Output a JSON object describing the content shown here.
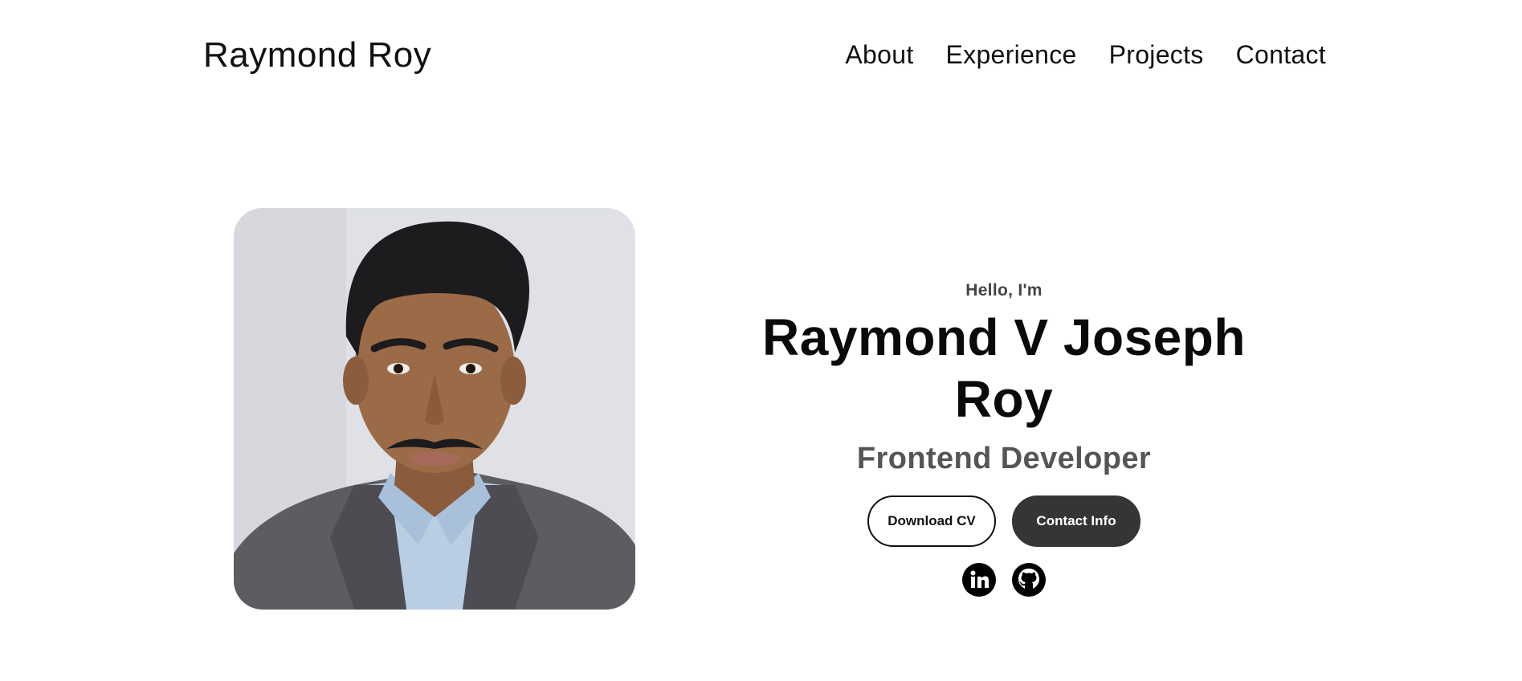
{
  "nav": {
    "logo": "Raymond Roy",
    "links": [
      "About",
      "Experience",
      "Projects",
      "Contact"
    ]
  },
  "hero": {
    "greeting": "Hello, I'm",
    "name": "Raymond V Joseph Roy",
    "title": "Frontend Developer",
    "buttons": {
      "download_cv": "Download CV",
      "contact_info": "Contact Info"
    },
    "socials": [
      "linkedin-icon",
      "github-icon"
    ],
    "profile_image": "profile-photo"
  },
  "colors": {
    "text": "#111111",
    "subtitle": "#555555",
    "button_dark": "#353535",
    "background": "#ffffff"
  }
}
